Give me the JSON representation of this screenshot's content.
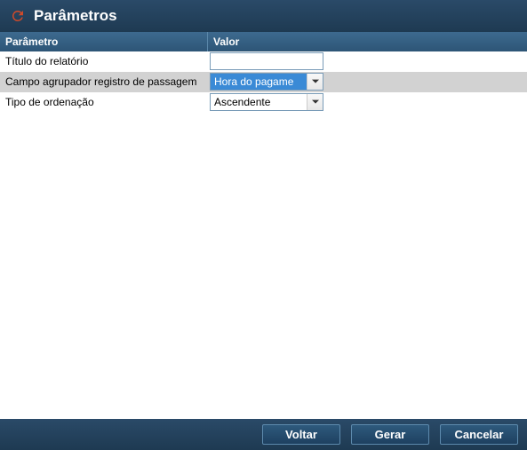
{
  "header": {
    "title": "Parâmetros"
  },
  "table": {
    "columns": {
      "param": "Parâmetro",
      "value": "Valor"
    },
    "rows": [
      {
        "label": "Título do relatório",
        "type": "text",
        "value": ""
      },
      {
        "label": "Campo agrupador registro de passagem",
        "type": "select",
        "value": "Hora do pagame",
        "highlighted": true
      },
      {
        "label": "Tipo de ordenação",
        "type": "select",
        "value": "Ascendente",
        "highlighted": false
      }
    ]
  },
  "footer": {
    "back": "Voltar",
    "generate": "Gerar",
    "cancel": "Cancelar"
  }
}
